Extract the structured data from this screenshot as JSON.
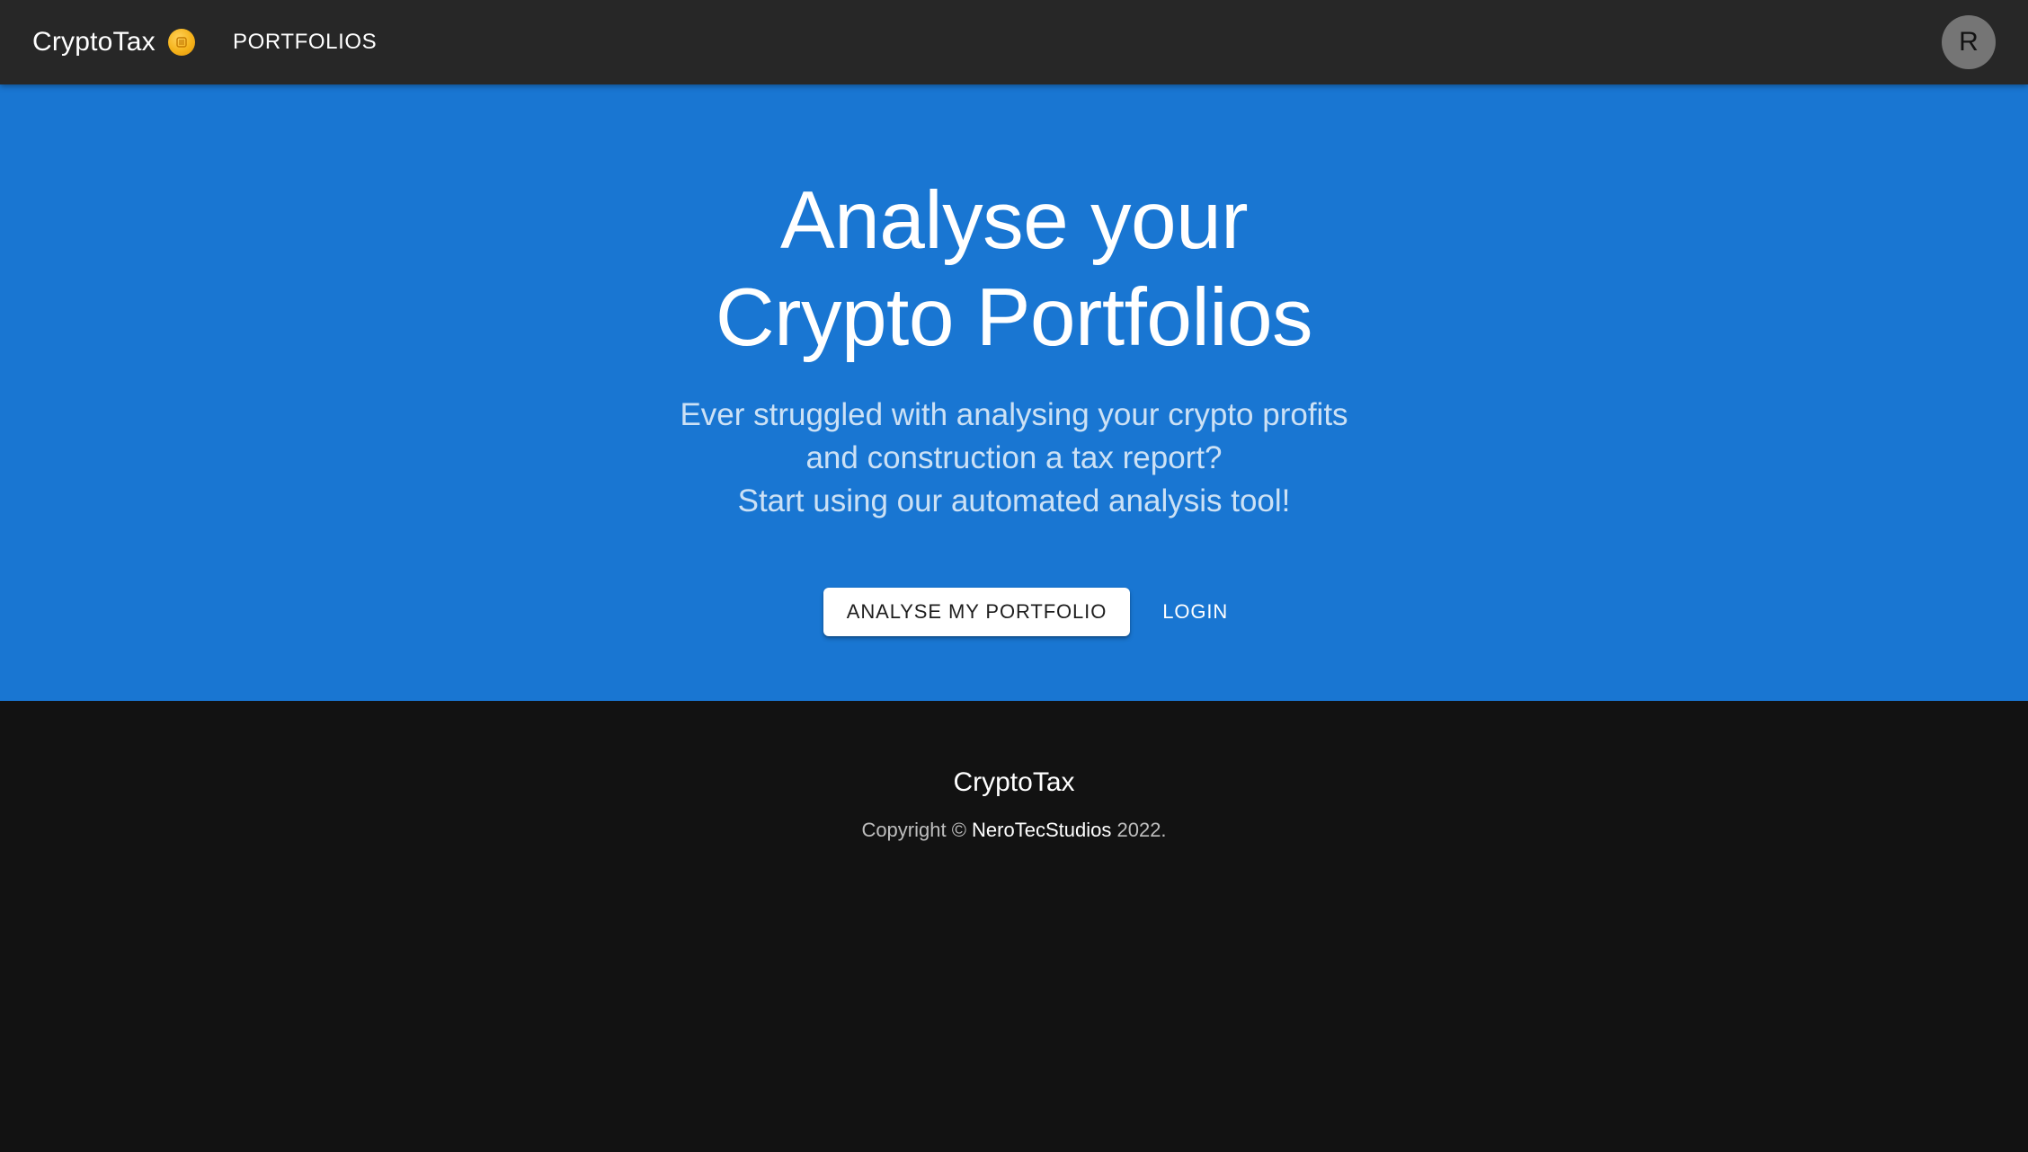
{
  "header": {
    "brand": "CryptoTax",
    "brand_icon": "coin-icon",
    "nav_portfolios": "PORTFOLIOS",
    "avatar_initial": "R"
  },
  "hero": {
    "title_line1": "Analyse your",
    "title_line2": "Crypto Portfolios",
    "subtitle_line1": "Ever struggled with analysing your crypto profits",
    "subtitle_line2": "and construction a tax report?",
    "subtitle_line3": "Start using our automated analysis tool!",
    "primary_button": "ANALYSE MY PORTFOLIO",
    "secondary_button": "LOGIN"
  },
  "footer": {
    "title": "CryptoTax",
    "copyright_prefix": "Copyright ©",
    "company": "NeroTecStudios",
    "year_suffix": "2022."
  },
  "colors": {
    "topbar": "#272727",
    "hero": "#1976d2",
    "footer": "#121212",
    "coin": "#f5b21a"
  }
}
